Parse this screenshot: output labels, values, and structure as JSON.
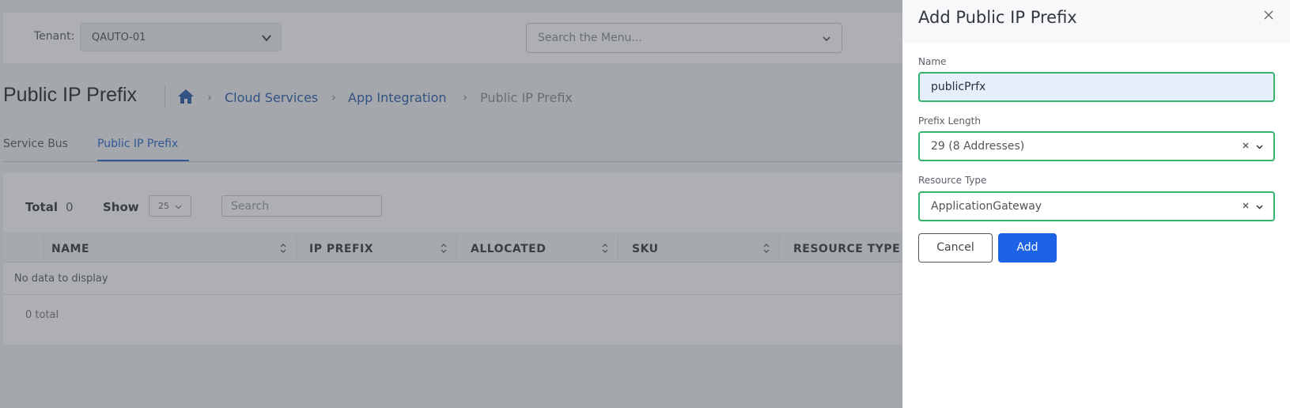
{
  "header": {
    "tenant_label": "Tenant:",
    "tenant_value": "QAUTO-01",
    "menu_search_placeholder": "Search the Menu..."
  },
  "page": {
    "title": "Public IP Prefix",
    "breadcrumb": [
      "Cloud Services",
      "App Integration",
      "Public IP Prefix"
    ]
  },
  "tabs": [
    {
      "label": "Service Bus",
      "active": false
    },
    {
      "label": "Public IP Prefix",
      "active": true
    }
  ],
  "table": {
    "total_label": "Total",
    "total_value": "0",
    "show_label": "Show",
    "page_size": "25",
    "search_placeholder": "Search",
    "columns": [
      "NAME",
      "IP PREFIX",
      "ALLOCATED",
      "SKU",
      "RESOURCE TYPE"
    ],
    "empty_text": "No data to display",
    "footer_total": "0 total"
  },
  "drawer": {
    "title": "Add Public IP Prefix",
    "name_label": "Name",
    "name_value": "publicPrfx",
    "prefix_label": "Prefix Length",
    "prefix_value": "29 (8 Addresses)",
    "resource_label": "Resource Type",
    "resource_value": "ApplicationGateway",
    "cancel_label": "Cancel",
    "add_label": "Add"
  },
  "colors": {
    "accent": "#1d63e6",
    "field_valid": "#37b36f",
    "link": "#2c5fad"
  }
}
